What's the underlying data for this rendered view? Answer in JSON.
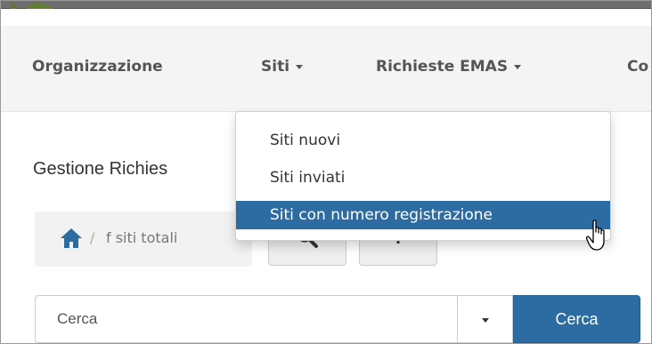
{
  "navbar": {
    "items": [
      {
        "label": "Organizzazione"
      },
      {
        "label": "Siti"
      },
      {
        "label": "Richieste EMAS"
      },
      {
        "label": "Co"
      }
    ]
  },
  "siti_menu": {
    "items": [
      {
        "label": "Siti nuovi"
      },
      {
        "label": "Siti inviati"
      },
      {
        "label": "Siti con numero registrazione",
        "active": true
      }
    ]
  },
  "page": {
    "title": "Gestione Richies"
  },
  "breadcrumb": {
    "separator": "/",
    "text": "f siti totali"
  },
  "search": {
    "placeholder": "Cerca",
    "button_label": "Cerca"
  },
  "colors": {
    "accent": "#2d6ca2",
    "navbar_bg": "#f4f4f4",
    "home_icon": "#2d6ca2"
  },
  "icons": [
    "home-icon",
    "search-icon",
    "hand-cursor-icon",
    "caret-down-icon"
  ]
}
